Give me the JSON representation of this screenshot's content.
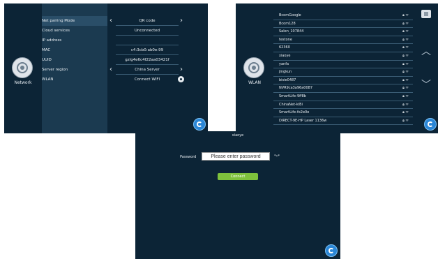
{
  "network": {
    "label": "Network",
    "rows": [
      {
        "label": "Net pairing Mode",
        "value": "QR code",
        "arrows": true
      },
      {
        "label": "Cloud services",
        "value": "Unconnected",
        "arrows": false
      },
      {
        "label": "IP address",
        "value": "",
        "arrows": false
      },
      {
        "label": "MAC",
        "value": "c4:3cb0:ab0e:99",
        "arrows": false
      },
      {
        "label": "UUID",
        "value": "gzlg4e6c4f22aa03421f",
        "arrows": false
      },
      {
        "label": "Server region",
        "value": "China Server",
        "arrows": true
      },
      {
        "label": "WLAN",
        "value": "Connect WIFI",
        "arrows": false
      }
    ]
  },
  "wlan": {
    "label": "WLAN",
    "networks": [
      "BcomGoogle",
      "Bcom128",
      "Salen_107844",
      "testone",
      "62360",
      "xiaoye",
      "yanfa",
      "jingkun",
      "bisie0487",
      "NVR9ca3a96a0087",
      "SmartLife-9ff8b",
      "ChinaNet-kiBi",
      "SmartLife-fe2e0e",
      "DIRECT-9E-HP Laser 1136w"
    ]
  },
  "password_screen": {
    "ssid": "xiaoye",
    "password_label": "Password",
    "placeholder": "Please enter password",
    "show_toggle": "*•*",
    "connect_label": "Connect"
  },
  "colors": {
    "background": "#0c2436",
    "panel": "#1b3a50",
    "accent_blue": "#2a86d6",
    "connect_green": "#7ec13c"
  }
}
